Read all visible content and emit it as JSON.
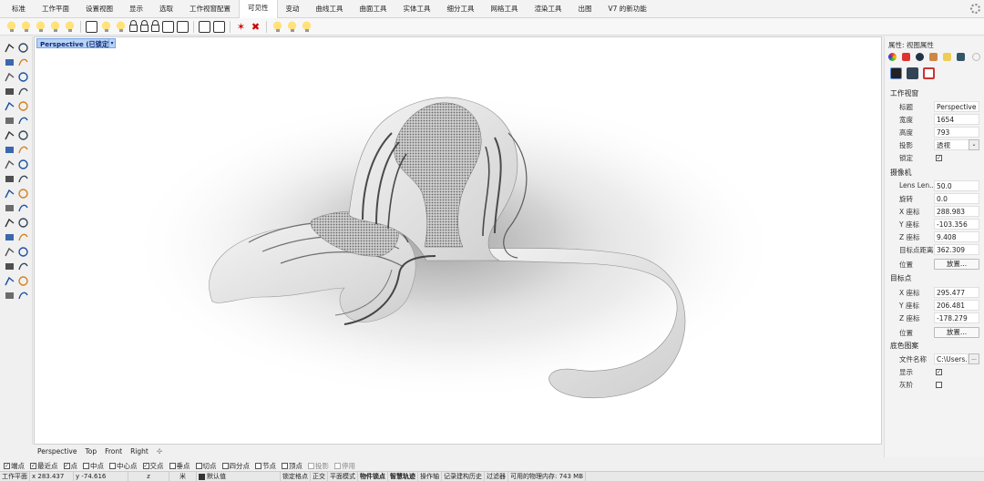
{
  "menu_tabs": [
    "标准",
    "工作平面",
    "设置视图",
    "显示",
    "选取",
    "工作视窗配置",
    "可见性",
    "变动",
    "曲线工具",
    "曲面工具",
    "实体工具",
    "细分工具",
    "网格工具",
    "渲染工具",
    "出图",
    "V7 的新功能"
  ],
  "active_tab_index": 6,
  "viewport": {
    "title": "Perspective (已锁定)",
    "tabs": [
      "Perspective",
      "Top",
      "Front",
      "Right"
    ],
    "add_tab_symbol": "✣"
  },
  "properties": {
    "header": "属性: 视图属性",
    "sections": {
      "viewport": "工作视窗",
      "camera": "摄像机",
      "target": "目标点",
      "wallpaper": "底色图案"
    },
    "viewport_rows": [
      {
        "label": "标题",
        "value": "Perspective"
      },
      {
        "label": "宽度",
        "value": "1654"
      },
      {
        "label": "高度",
        "value": "793"
      },
      {
        "label": "投影",
        "value": "透视"
      },
      {
        "label": "锁定",
        "value": "☑"
      }
    ],
    "camera_rows": [
      {
        "label": "Lens Len...",
        "value": "50.0"
      },
      {
        "label": "旋转",
        "value": "0.0"
      },
      {
        "label": "X 座标",
        "value": "288.983"
      },
      {
        "label": "Y 座标",
        "value": "-103.356"
      },
      {
        "label": "Z 座标",
        "value": "9.408"
      },
      {
        "label": "目标点距离",
        "value": "362.309"
      }
    ],
    "camera_position_label": "位置",
    "place_button": "放置...",
    "target_rows": [
      {
        "label": "X 座标",
        "value": "295.477"
      },
      {
        "label": "Y 座标",
        "value": "206.481"
      },
      {
        "label": "Z 座标",
        "value": "-178.279"
      }
    ],
    "target_position_label": "位置",
    "wallpaper_rows": [
      {
        "label": "文件名称",
        "value": "C:\\Users..."
      },
      {
        "label": "显示",
        "value": "☑"
      },
      {
        "label": "灰阶",
        "value": "☐"
      }
    ],
    "browse_button": "..."
  },
  "osnaps": [
    {
      "label": "端点",
      "checked": true
    },
    {
      "label": "最近点",
      "checked": true
    },
    {
      "label": "点",
      "checked": true
    },
    {
      "label": "中点",
      "checked": false
    },
    {
      "label": "中心点",
      "checked": false
    },
    {
      "label": "交点",
      "checked": true
    },
    {
      "label": "垂点",
      "checked": false
    },
    {
      "label": "切点",
      "checked": false
    },
    {
      "label": "四分点",
      "checked": false
    },
    {
      "label": "节点",
      "checked": false
    },
    {
      "label": "顶点",
      "checked": false
    },
    {
      "label": "投影",
      "checked": false,
      "disabled": true
    },
    {
      "label": "停用",
      "checked": false,
      "disabled": true
    }
  ],
  "status": {
    "cplane": "工作平面",
    "x": "x 283.437",
    "y": "y -74.616",
    "z": "z",
    "unit": "米",
    "layer": "默认值",
    "toggles": [
      "锁定格点",
      "正交",
      "平面模式",
      "物件锁点",
      "智慧轨迹",
      "操作轴",
      "记录建构历史",
      "过滤器"
    ],
    "memory": "可用的物理内存: 743 MB"
  }
}
